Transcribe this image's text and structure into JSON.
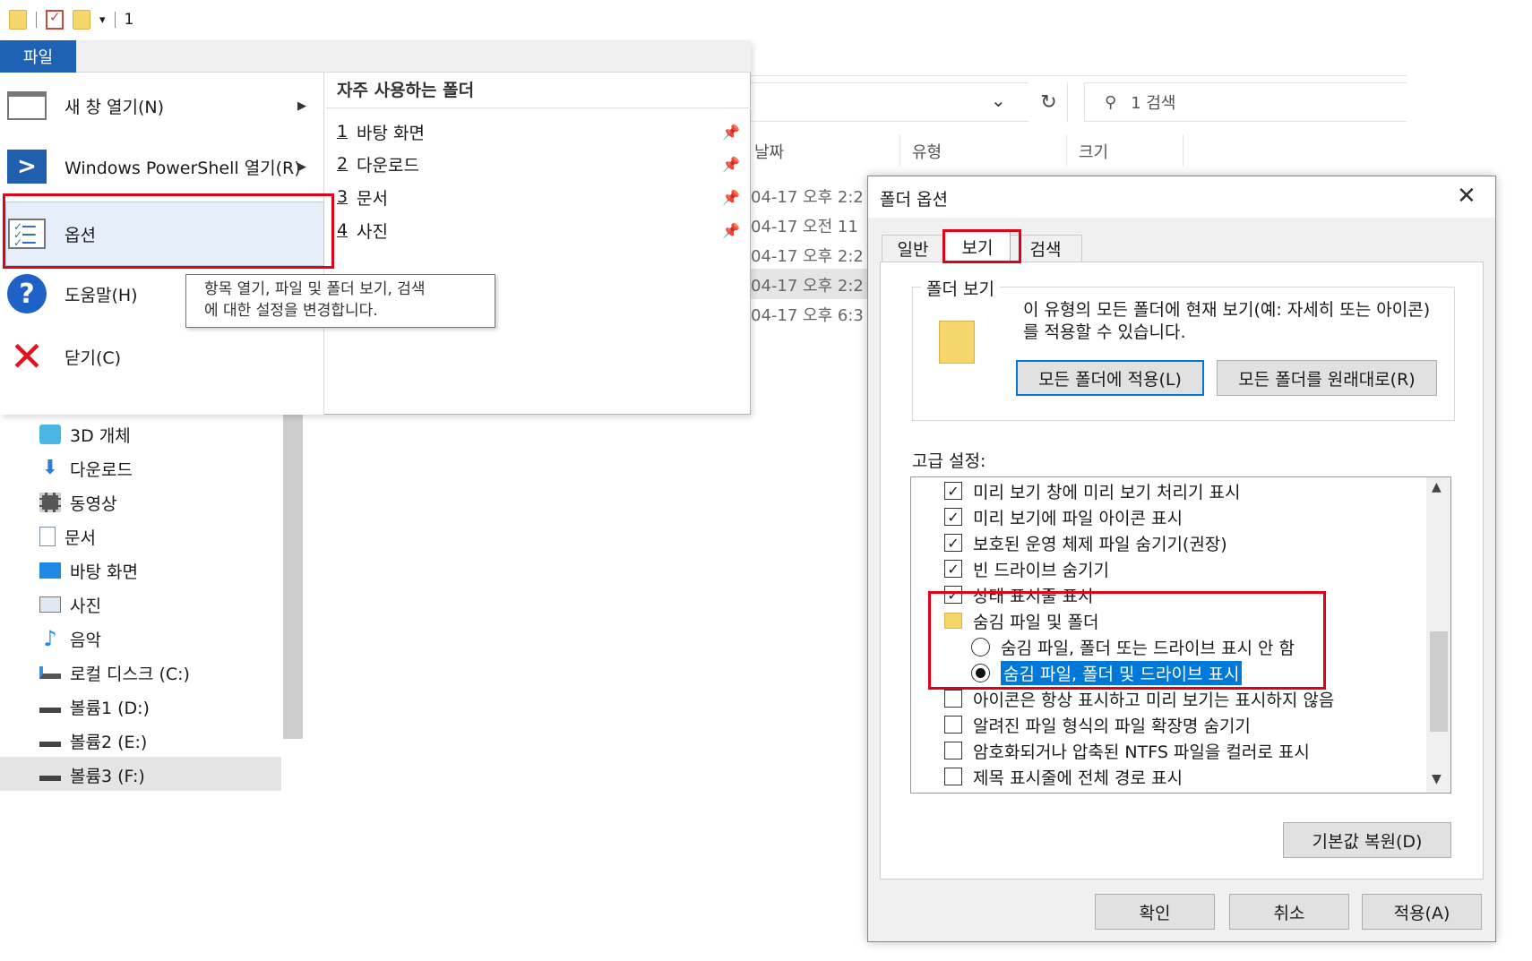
{
  "qat": {
    "number": "1"
  },
  "explorer": {
    "search_placeholder": "1 검색",
    "columns": {
      "date": "날짜",
      "type": "유형",
      "size": "크기"
    },
    "dates": [
      "04-17 오후 2:2",
      "04-17 오전 11",
      "04-17 오후 2:2",
      "04-17 오후 2:2",
      "04-17 오후 6:3"
    ],
    "nav": [
      {
        "label": "3D 개체",
        "icon": "3d-objects-icon"
      },
      {
        "label": "다운로드",
        "icon": "download-icon"
      },
      {
        "label": "동영상",
        "icon": "video-icon"
      },
      {
        "label": "문서",
        "icon": "document-icon"
      },
      {
        "label": "바탕 화면",
        "icon": "desktop-icon"
      },
      {
        "label": "사진",
        "icon": "pictures-icon"
      },
      {
        "label": "음악",
        "icon": "music-icon"
      },
      {
        "label": "로컬 디스크 (C:)",
        "icon": "local-disk-icon"
      },
      {
        "label": "볼륨1 (D:)",
        "icon": "drive-icon"
      },
      {
        "label": "볼륨2 (E:)",
        "icon": "drive-icon"
      },
      {
        "label": "볼륨3 (F:)",
        "icon": "drive-icon"
      }
    ]
  },
  "file_menu": {
    "tab": "파일",
    "items": {
      "new_window": "새 창 열기(N)",
      "powershell": "Windows PowerShell 열기(R)",
      "options": "옵션",
      "help": "도움말(H)",
      "close": "닫기(C)"
    },
    "recent_title": "자주 사용하는 폴더",
    "recent": [
      {
        "num": "1",
        "label": "바탕 화면"
      },
      {
        "num": "2",
        "label": "다운로드"
      },
      {
        "num": "3",
        "label": "문서"
      },
      {
        "num": "4",
        "label": "사진"
      }
    ],
    "tooltip": [
      "항목 열기, 파일 및 폴더 보기, 검색",
      "에 대한 설정을 변경합니다."
    ]
  },
  "dialog": {
    "title": "폴더 옵션",
    "tabs": [
      "일반",
      "보기",
      "검색"
    ],
    "group_label": "폴더 보기",
    "group_desc": "이 유형의 모든 폴더에 현재 보기(예: 자세히 또는 아이콘)를 적용할 수 있습니다.",
    "apply_all": "모든 폴더에 적용(L)",
    "reset_all": "모든 폴더를 원래대로(R)",
    "advanced_label": "고급 설정:",
    "settings": [
      {
        "type": "checkbox",
        "checked": true,
        "label": "미리 보기 창에 미리 보기 처리기 표시"
      },
      {
        "type": "checkbox",
        "checked": true,
        "label": "미리 보기에 파일 아이콘 표시"
      },
      {
        "type": "checkbox",
        "checked": true,
        "label": "보호된 운영 체제 파일 숨기기(권장)"
      },
      {
        "type": "checkbox",
        "checked": true,
        "label": "빈 드라이브 숨기기"
      },
      {
        "type": "checkbox",
        "checked": true,
        "label": "상태 표시줄 표시"
      },
      {
        "type": "folder",
        "label": "숨김 파일 및 폴더"
      },
      {
        "type": "radio",
        "checked": false,
        "label": "숨김 파일, 폴더 또는 드라이브 표시 안 함"
      },
      {
        "type": "radio",
        "checked": true,
        "label": "숨김 파일, 폴더 및 드라이브 표시"
      },
      {
        "type": "checkbox",
        "checked": false,
        "label": "아이콘은 항상 표시하고 미리 보기는 표시하지 않음"
      },
      {
        "type": "checkbox",
        "checked": false,
        "label": "알려진 파일 형식의 파일 확장명 숨기기"
      },
      {
        "type": "checkbox",
        "checked": false,
        "label": "암호화되거나 압축된 NTFS 파일을 컬러로 표시"
      },
      {
        "type": "checkbox",
        "checked": false,
        "label": "제목 표시줄에 전체 경로 표시"
      }
    ],
    "restore_defaults": "기본값 복원(D)",
    "ok": "확인",
    "cancel": "취소",
    "apply": "적용(A)"
  }
}
